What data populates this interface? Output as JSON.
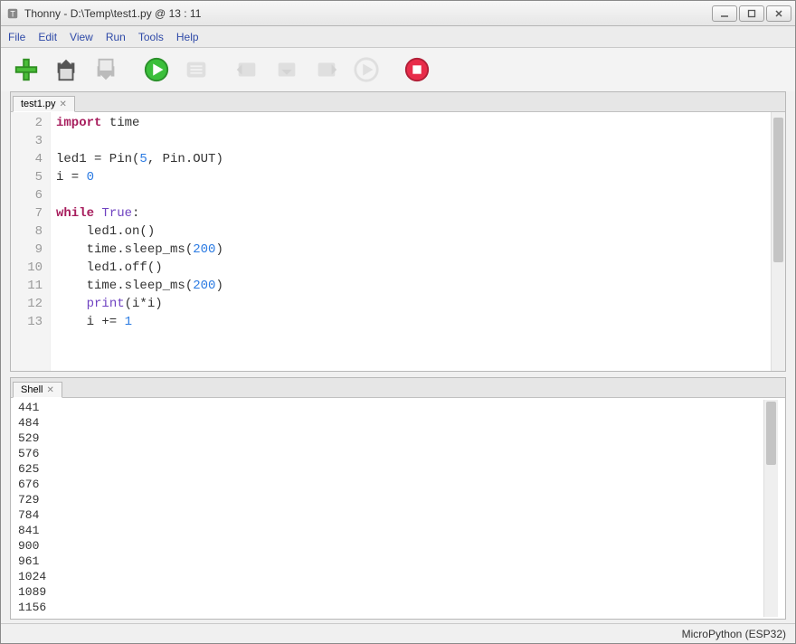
{
  "window": {
    "title": "Thonny  -  D:\\Temp\\test1.py  @  13 : 11"
  },
  "menu": {
    "file": "File",
    "edit": "Edit",
    "view": "View",
    "run": "Run",
    "tools": "Tools",
    "help": "Help"
  },
  "editor": {
    "tab_label": "test1.py",
    "gutter_start": 2,
    "lines": [
      {
        "n": "",
        "seg": [
          [
            "kw",
            "import"
          ],
          [
            "",
            " time"
          ]
        ]
      },
      {
        "n": "",
        "seg": []
      },
      {
        "n": "",
        "seg": [
          [
            "",
            "led1 = Pin("
          ],
          [
            "num",
            "5"
          ],
          [
            "",
            ", Pin.OUT)"
          ]
        ]
      },
      {
        "n": "",
        "seg": [
          [
            "",
            "i = "
          ],
          [
            "num",
            "0"
          ]
        ]
      },
      {
        "n": "",
        "seg": []
      },
      {
        "n": "",
        "seg": [
          [
            "kw",
            "while"
          ],
          [
            "",
            " "
          ],
          [
            "bkw",
            "True"
          ],
          [
            "",
            ":"
          ]
        ]
      },
      {
        "n": "",
        "seg": [
          [
            "",
            "    led1.on()"
          ]
        ]
      },
      {
        "n": "",
        "seg": [
          [
            "",
            "    time.sleep_ms("
          ],
          [
            "num",
            "200"
          ],
          [
            "",
            ")"
          ]
        ]
      },
      {
        "n": "",
        "seg": [
          [
            "",
            "    led1.off()"
          ]
        ]
      },
      {
        "n": "",
        "seg": [
          [
            "",
            "    time.sleep_ms("
          ],
          [
            "num",
            "200"
          ],
          [
            "",
            ")"
          ]
        ]
      },
      {
        "n": "",
        "seg": [
          [
            "",
            "    "
          ],
          [
            "bkw",
            "print"
          ],
          [
            "",
            "(i*i)"
          ]
        ]
      },
      {
        "n": "",
        "seg": [
          [
            "",
            "    i += "
          ],
          [
            "num",
            "1"
          ]
        ]
      }
    ]
  },
  "shell": {
    "tab_label": "Shell",
    "lines": [
      "441",
      "484",
      "529",
      "576",
      "625",
      "676",
      "729",
      "784",
      "841",
      "900",
      "961",
      "1024",
      "1089",
      "1156"
    ]
  },
  "status": {
    "backend": "MicroPython (ESP32)"
  }
}
